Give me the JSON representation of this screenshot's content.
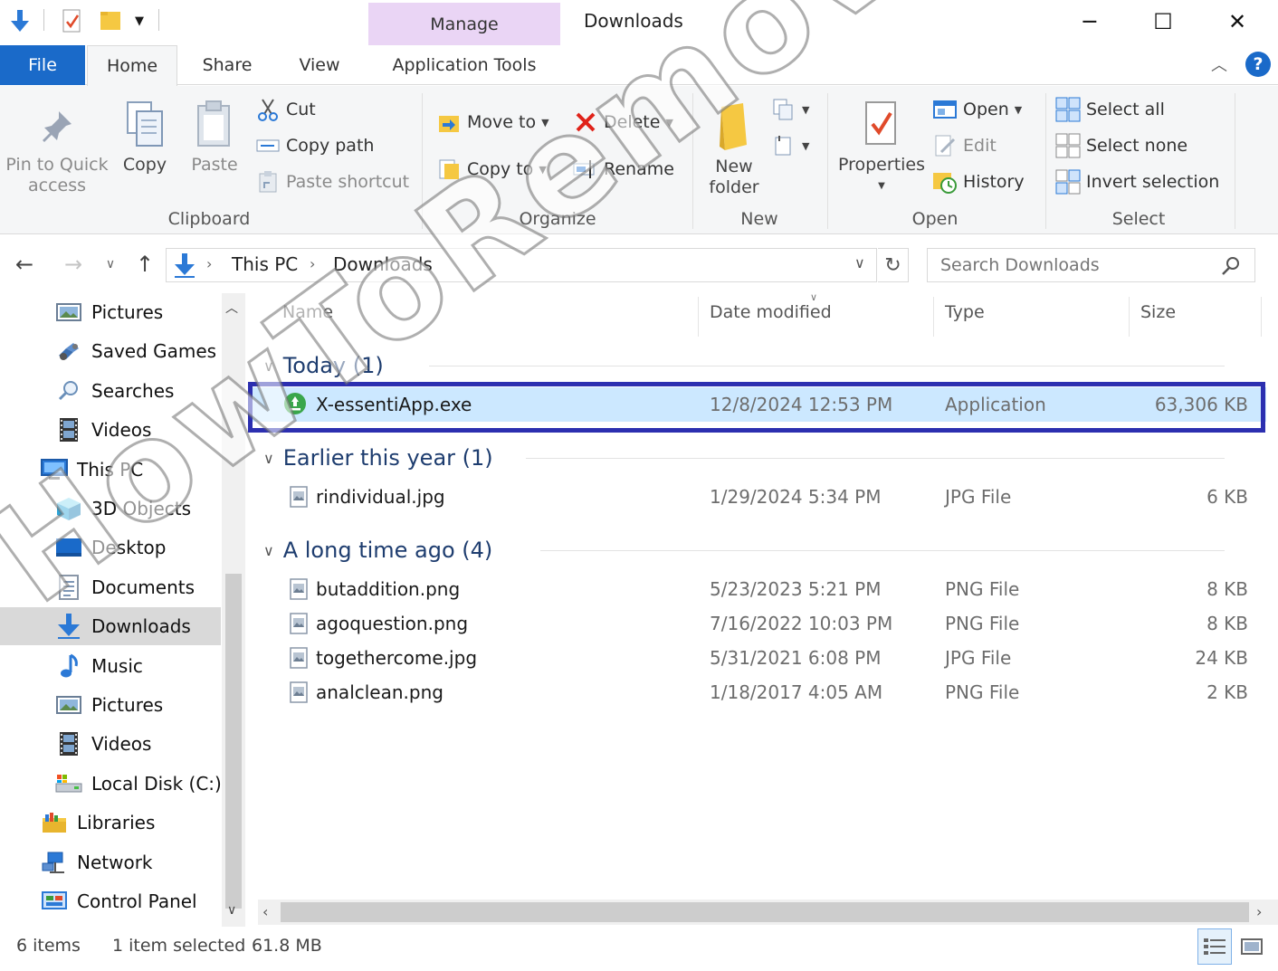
{
  "window": {
    "title": "Downloads",
    "context_tab": "Manage",
    "minimize_glyph": "─",
    "maximize_glyph": "☐",
    "close_glyph": "✕"
  },
  "tabs": {
    "file": "File",
    "home": "Home",
    "share": "Share",
    "view": "View",
    "app_tools": "Application Tools"
  },
  "help_label": "?",
  "ribbon": {
    "clipboard": {
      "label": "Clipboard",
      "pin": "Pin to Quick access",
      "copy": "Copy",
      "paste": "Paste",
      "cut": "Cut",
      "copy_path": "Copy path",
      "paste_shortcut": "Paste shortcut"
    },
    "organize": {
      "label": "Organize",
      "move_to": "Move to",
      "copy_to": "Copy to",
      "delete": "Delete",
      "rename": "Rename"
    },
    "new": {
      "label": "New",
      "new_folder": "New folder"
    },
    "open": {
      "label": "Open",
      "properties": "Properties",
      "open": "Open",
      "edit": "Edit",
      "history": "History"
    },
    "select": {
      "label": "Select",
      "select_all": "Select all",
      "select_none": "Select none",
      "invert_selection": "Invert selection"
    }
  },
  "address": {
    "crumbs": [
      "This PC",
      "Downloads"
    ],
    "search_placeholder": "Search Downloads"
  },
  "nav_pane": {
    "items": [
      {
        "label": "Pictures",
        "icon": "pictures-icon"
      },
      {
        "label": "Saved Games",
        "icon": "saved-games-icon"
      },
      {
        "label": "Searches",
        "icon": "searches-icon"
      },
      {
        "label": "Videos",
        "icon": "videos-icon"
      },
      {
        "label": "This PC",
        "icon": "this-pc-icon"
      },
      {
        "label": "3D Objects",
        "icon": "3d-objects-icon"
      },
      {
        "label": "Desktop",
        "icon": "desktop-icon"
      },
      {
        "label": "Documents",
        "icon": "documents-icon"
      },
      {
        "label": "Downloads",
        "icon": "downloads-icon"
      },
      {
        "label": "Music",
        "icon": "music-icon"
      },
      {
        "label": "Pictures",
        "icon": "pictures-icon"
      },
      {
        "label": "Videos",
        "icon": "videos-icon"
      },
      {
        "label": "Local Disk (C:)",
        "icon": "local-disk-icon"
      },
      {
        "label": "Libraries",
        "icon": "libraries-icon"
      },
      {
        "label": "Network",
        "icon": "network-icon"
      },
      {
        "label": "Control Panel",
        "icon": "control-panel-icon"
      }
    ],
    "selected": "Downloads"
  },
  "file_list": {
    "columns": {
      "name": "Name",
      "date": "Date modified",
      "type": "Type",
      "size": "Size"
    },
    "groups": [
      {
        "label": "Today (1)",
        "files": [
          {
            "name": "X-essentiApp.exe",
            "date": "12/8/2024 12:53 PM",
            "type": "Application",
            "size": "63,306 KB",
            "selected": true
          }
        ]
      },
      {
        "label": "Earlier this year (1)",
        "files": [
          {
            "name": "rindividual.jpg",
            "date": "1/29/2024 5:34 PM",
            "type": "JPG File",
            "size": "6 KB"
          }
        ]
      },
      {
        "label": "A long time ago (4)",
        "files": [
          {
            "name": "butaddition.png",
            "date": "5/23/2023 5:21 PM",
            "type": "PNG File",
            "size": "8 KB"
          },
          {
            "name": "agoquestion.png",
            "date": "7/16/2022 10:03 PM",
            "type": "PNG File",
            "size": "8 KB"
          },
          {
            "name": "togethercome.jpg",
            "date": "5/31/2021 6:08 PM",
            "type": "JPG File",
            "size": "24 KB"
          },
          {
            "name": "analclean.png",
            "date": "1/18/2017 4:05 AM",
            "type": "PNG File",
            "size": "2 KB"
          }
        ]
      }
    ]
  },
  "status": {
    "items": "6 items",
    "selected": "1 item selected",
    "selected_size": "61.8 MB"
  },
  "watermark": "HowToRemove.Guide",
  "colors": {
    "accent": "#1a6ac9",
    "context_tab": "#ead5f5",
    "selection": "#cce8ff",
    "highlight_box": "#2c2fb0",
    "group_header": "#1e3d6f"
  }
}
